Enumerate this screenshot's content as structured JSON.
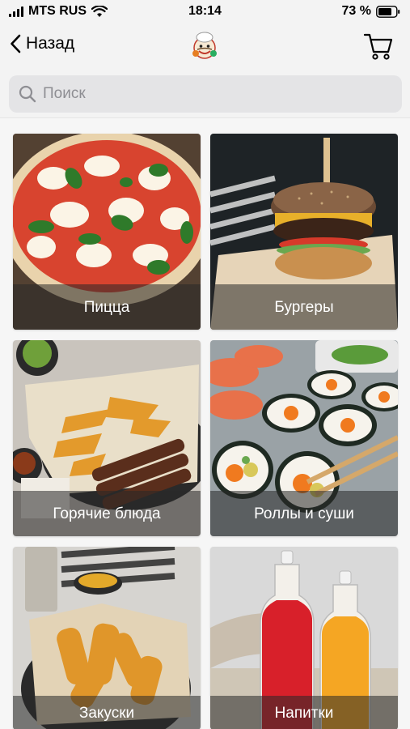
{
  "status_bar": {
    "carrier": "MTS RUS",
    "time": "18:14",
    "battery_percent": "73 %"
  },
  "nav": {
    "back_label": "Назад"
  },
  "search": {
    "placeholder": "Поиск"
  },
  "categories": [
    {
      "label": "Пицца",
      "icon": "pizza-image"
    },
    {
      "label": "Бургеры",
      "icon": "burger-image"
    },
    {
      "label": "Горячие блюда",
      "icon": "hot-dishes-image"
    },
    {
      "label": "Роллы и суши",
      "icon": "sushi-image"
    },
    {
      "label": "Закуски",
      "icon": "snacks-image"
    },
    {
      "label": "Напитки",
      "icon": "drinks-image"
    }
  ],
  "colors": {
    "bar_background": "#f3f3f3",
    "search_background": "#e4e4e6",
    "label_overlay": "rgba(40,40,40,0.55)"
  }
}
